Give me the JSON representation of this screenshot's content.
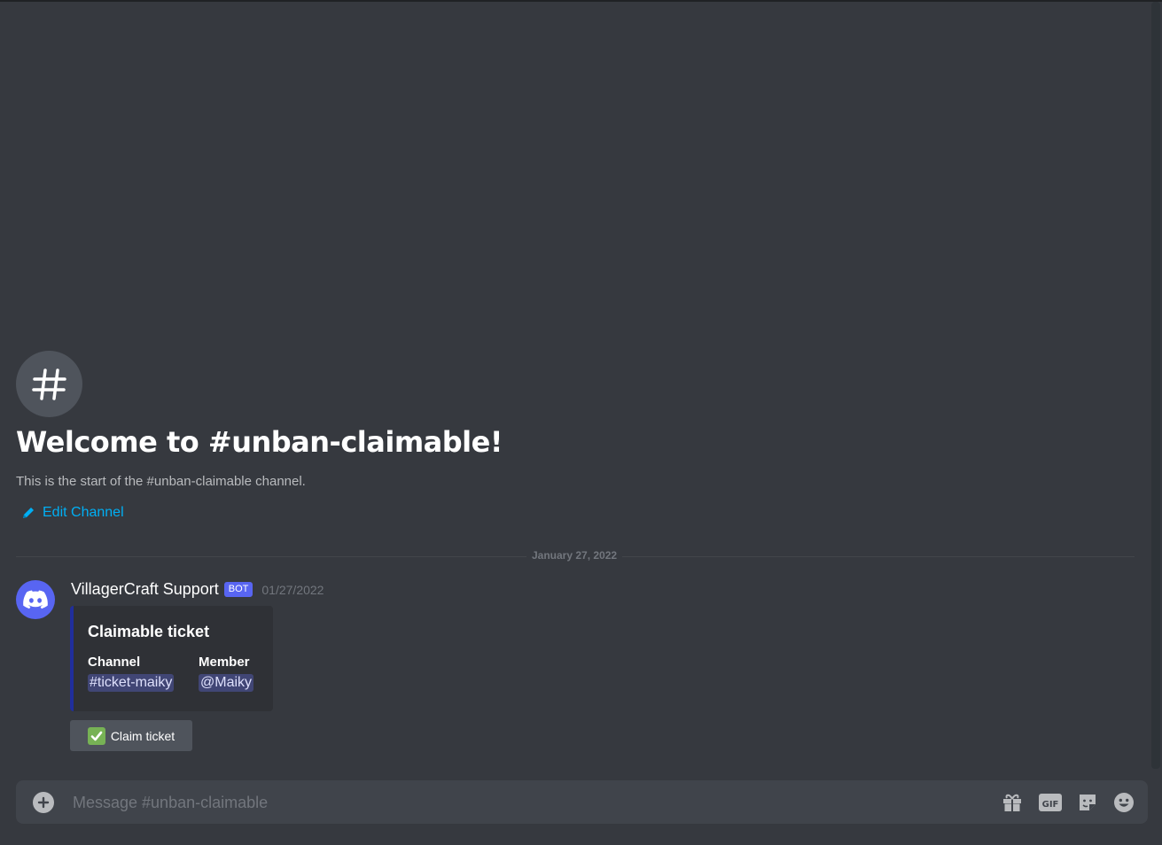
{
  "channel": {
    "welcome_title": "Welcome to #unban-claimable!",
    "welcome_subtitle": "This is the start of the #unban-claimable channel.",
    "edit_label": "Edit Channel"
  },
  "divider": {
    "date_label": "January 27, 2022"
  },
  "message": {
    "author": "VillagerCraft Support",
    "bot_tag": "BOT",
    "timestamp": "01/27/2022",
    "embed": {
      "title": "Claimable ticket",
      "fields": [
        {
          "name": "Channel",
          "value": "ticket-maiky",
          "prefix": "#"
        },
        {
          "name": "Member",
          "value": "@Maiky"
        }
      ],
      "accent_color": "#202e9c"
    },
    "button": {
      "label": "Claim ticket",
      "emoji": "white-check-mark-icon"
    }
  },
  "composer": {
    "placeholder": "Message #unban-claimable",
    "icons": [
      "add-icon",
      "gift-icon",
      "gif-icon",
      "sticker-icon",
      "emoji-icon"
    ]
  },
  "colors": {
    "background": "#36393f",
    "link": "#00aff4",
    "blurple": "#5865f2",
    "mention_bg": "#414675"
  }
}
